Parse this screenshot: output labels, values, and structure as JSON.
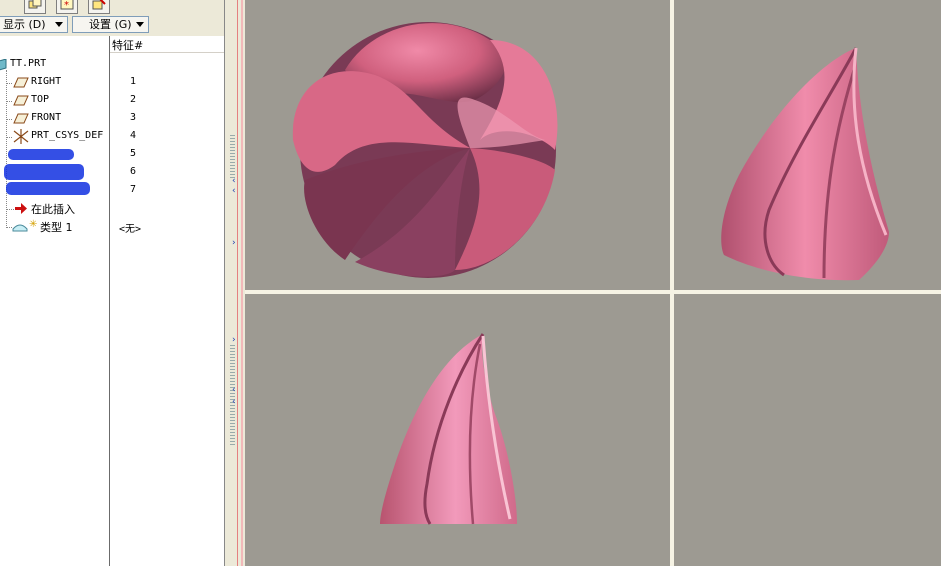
{
  "menubar": {
    "display_label": "显示 (D)",
    "settings_label": "设置 (G)"
  },
  "tree": {
    "column_header": "特征#",
    "items": [
      {
        "label": "TT.PRT",
        "num": ""
      },
      {
        "label": "RIGHT",
        "num": "1"
      },
      {
        "label": "TOP",
        "num": "2"
      },
      {
        "label": "FRONT",
        "num": "3"
      },
      {
        "label": "PRT_CSYS_DEF",
        "num": "4"
      },
      {
        "label": "",
        "num": "5"
      },
      {
        "label": "",
        "num": "6"
      },
      {
        "label": "",
        "num": "7"
      },
      {
        "label": "在此插入",
        "num": ""
      },
      {
        "label": "类型 1",
        "num": "<无>"
      }
    ]
  },
  "colors": {
    "viewport_bg": "#9d9a92",
    "model_pink": "#e0708f",
    "model_shadow": "#7c3a54",
    "scribble": "#1030e0"
  }
}
